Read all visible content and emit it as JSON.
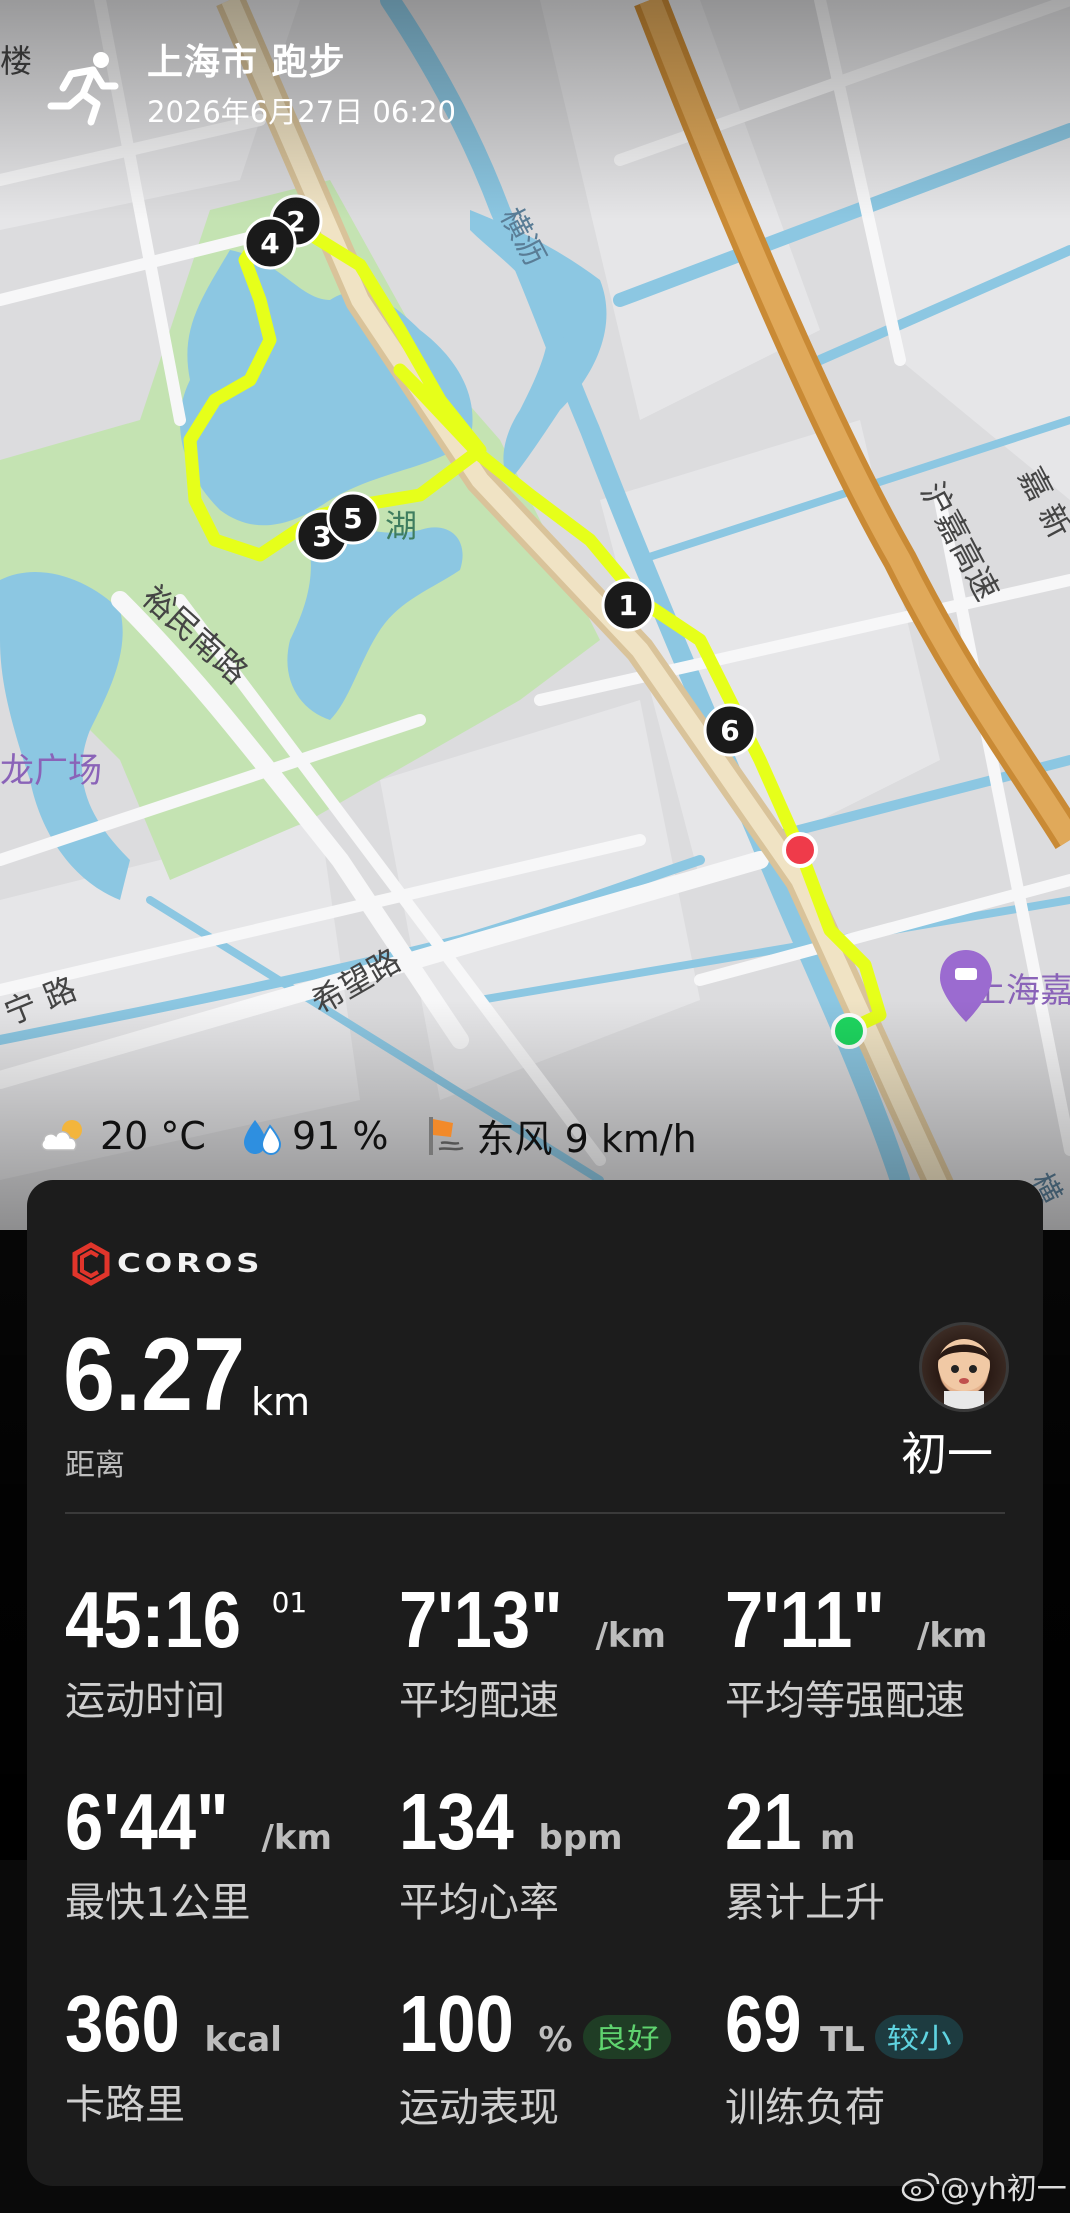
{
  "header": {
    "title": "上海市 跑步",
    "datetime": "2026年6月27日 06:20"
  },
  "map": {
    "labels": {
      "road_hengli": "横沥",
      "road_hujia": "沪嘉高速",
      "road_yumin": "裕民南路",
      "road_xiwang": "希望路",
      "road_ning": "宁 路",
      "plaza": "龙广场",
      "lake": "湖",
      "top_left": "楼",
      "right_jia": "嘉 新",
      "poi": "上海嘉 智选假",
      "bottom_heng": "横"
    },
    "lap_markers": [
      "1",
      "2",
      "3",
      "4",
      "5",
      "6"
    ],
    "route_color": "#e6ff1a"
  },
  "weather": {
    "temperature": "20 °C",
    "humidity": "91 %",
    "wind": "东风 9 km/h"
  },
  "card": {
    "brand": "COROS",
    "distance": {
      "value": "6.27",
      "unit": "km",
      "label": "距离"
    },
    "user_name": "初一",
    "stats": [
      {
        "value": "45:16",
        "sup": "01",
        "unit": "",
        "label": "运动时间"
      },
      {
        "value": "7'13\"",
        "unit": "/km",
        "label": "平均配速"
      },
      {
        "value": "7'11\"",
        "unit": "/km",
        "label": "平均等强配速"
      },
      {
        "value": "6'44\"",
        "unit": "/km",
        "label": "最快1公里"
      },
      {
        "value": "134",
        "unit": "bpm",
        "label": "平均心率"
      },
      {
        "value": "21",
        "unit": "m",
        "label": "累计上升"
      },
      {
        "value": "360",
        "unit": "kcal",
        "label": "卡路里"
      },
      {
        "value": "100",
        "unit": "%",
        "badge": "良好",
        "label": "运动表现"
      },
      {
        "value": "69",
        "unit": "TL",
        "badge": "较小",
        "label": "训练负荷"
      }
    ]
  },
  "watermark": "@yh初一"
}
